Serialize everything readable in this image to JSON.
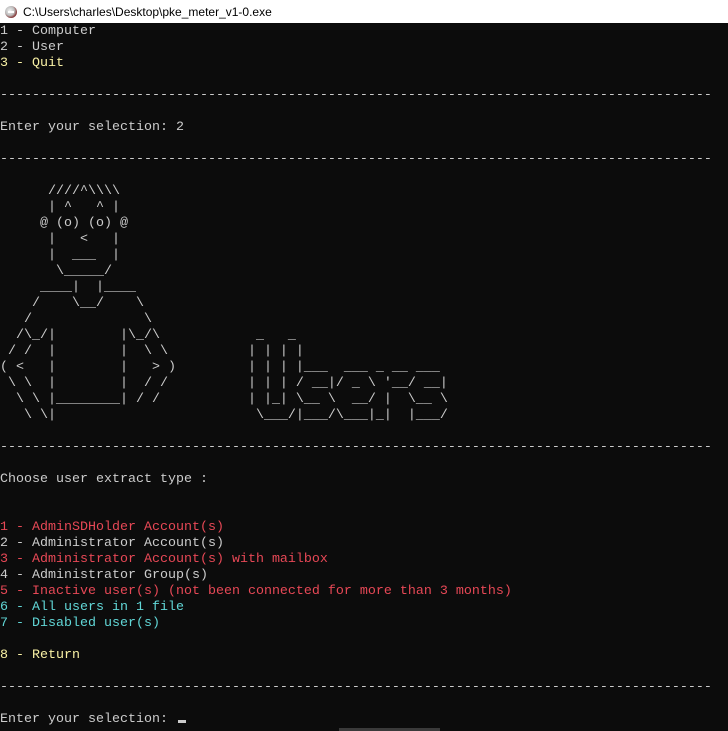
{
  "window": {
    "title": "C:\\Users\\charles\\Desktop\\pke_meter_v1-0.exe",
    "icon": "app-icon"
  },
  "top_menu": [
    {
      "text": "1 - Computer",
      "color": "#cccccc"
    },
    {
      "text": "2 - User",
      "color": "#cccccc"
    },
    {
      "text": "3 - Quit",
      "color": "#f9f1a5"
    }
  ],
  "separator": "-----------------------------------------------------------------------------------------",
  "first_prompt": "Enter your selection: 2",
  "ascii_art": [
    "      ////^\\\\\\\\",
    "      | ^   ^ |",
    "     @ (o) (o) @",
    "      |   <   |",
    "      |  ___  |",
    "       \\_____/",
    "     ____|  |____",
    "    /    \\__/    \\",
    "   /              \\",
    "  /\\_/|        |\\_/\\            _   _",
    " / /  |        |  \\ \\          | | | |",
    "( <   |        |   > )         | | | |___  ___ _ __ ___",
    " \\ \\  |        |  / /          | | | / __|/ _ \\ '__/ __|",
    "  \\ \\ |________| / /           | |_| \\__ \\  __/ |  \\__ \\",
    "   \\ \\|                         \\___/|___/\\___|_|  |___/"
  ],
  "extract_heading": "Choose user extract type :",
  "extract_options": [
    {
      "text": "1 - AdminSDHolder Account(s)",
      "color": "#e74856"
    },
    {
      "text": "2 - Administrator Account(s)",
      "color": "#cccccc"
    },
    {
      "text": "3 - Administrator Account(s) with mailbox",
      "color": "#e74856"
    },
    {
      "text": "4 - Administrator Group(s)",
      "color": "#cccccc"
    },
    {
      "text": "5 - Inactive user(s) (not been connected for more than 3 months)",
      "color": "#e74856"
    },
    {
      "text": "6 - All users in 1 file",
      "color": "#61d6d6"
    },
    {
      "text": "7 - Disabled user(s)",
      "color": "#61d6d6"
    }
  ],
  "return_option": {
    "text": "8 - Return",
    "color": "#f9f1a5"
  },
  "final_prompt": "Enter your selection: "
}
